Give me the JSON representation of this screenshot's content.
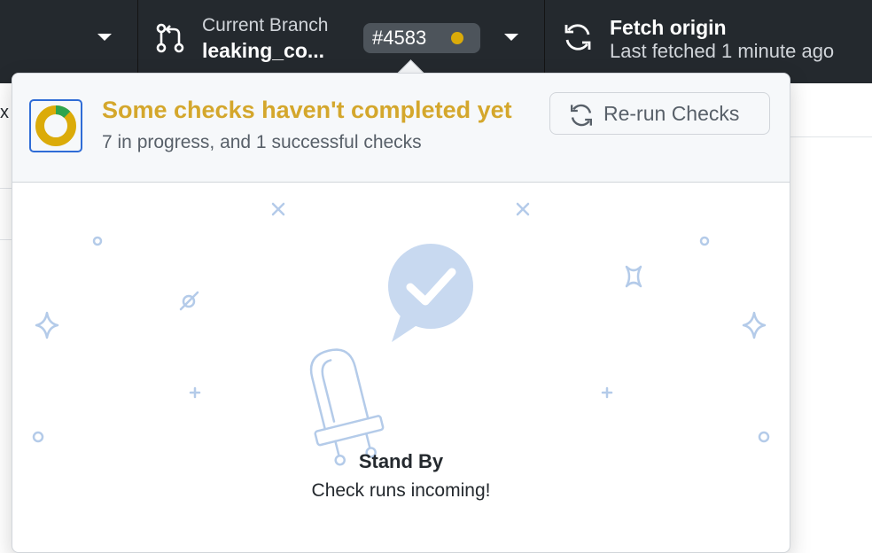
{
  "toolbar": {
    "branch": {
      "title": "Current Branch",
      "name": "leaking_co...",
      "pr_number": "#4583",
      "status_color": "#dbab09",
      "icon": "git-branch-icon"
    },
    "fetch": {
      "title": "Fetch origin",
      "subtitle": "Last fetched 1 minute ago",
      "icon": "sync-icon"
    }
  },
  "background": {
    "partial_text": "x"
  },
  "checks_popover": {
    "status_title": "Some checks haven't completed yet",
    "status_summary": "7 in progress, and 1 successful checks",
    "rerun_label": "Re-run Checks",
    "rerun_icon": "sync-icon",
    "progress": {
      "in_progress": 7,
      "successful": 1
    },
    "colors": {
      "pending": "#dbab09",
      "success": "#2da44e",
      "accent": "#2f6cd6"
    },
    "empty_state": {
      "title": "Stand By",
      "message": "Check runs incoming!",
      "illustration": "robot-with-check-bubble"
    }
  }
}
